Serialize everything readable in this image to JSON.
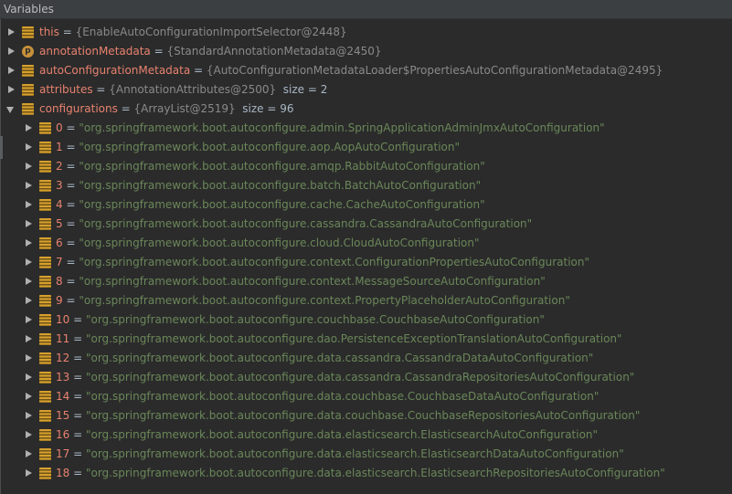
{
  "panel": {
    "title": "Variables"
  },
  "top_vars": [
    {
      "name": "this",
      "value": "{EnableAutoConfigurationImportSelector@2448}",
      "icon": "field-icon",
      "size_text": ""
    },
    {
      "name": "annotationMetadata",
      "value": "{StandardAnnotationMetadata@2450}",
      "icon": "param-icon",
      "icon_letter": "p",
      "size_text": ""
    },
    {
      "name": "autoConfigurationMetadata",
      "value": "{AutoConfigurationMetadataLoader$PropertiesAutoConfigurationMetadata@2495}",
      "icon": "field-icon",
      "size_text": ""
    },
    {
      "name": "attributes",
      "value": "{AnnotationAttributes@2500}",
      "icon": "field-icon",
      "size_text": "size = 2"
    },
    {
      "name": "configurations",
      "value": "{ArrayList@2519}",
      "icon": "field-icon",
      "size_text": "size = 96",
      "expanded": true
    }
  ],
  "items": [
    {
      "index": "0",
      "value": "\"org.springframework.boot.autoconfigure.admin.SpringApplicationAdminJmxAutoConfiguration\""
    },
    {
      "index": "1",
      "value": "\"org.springframework.boot.autoconfigure.aop.AopAutoConfiguration\""
    },
    {
      "index": "2",
      "value": "\"org.springframework.boot.autoconfigure.amqp.RabbitAutoConfiguration\""
    },
    {
      "index": "3",
      "value": "\"org.springframework.boot.autoconfigure.batch.BatchAutoConfiguration\""
    },
    {
      "index": "4",
      "value": "\"org.springframework.boot.autoconfigure.cache.CacheAutoConfiguration\""
    },
    {
      "index": "5",
      "value": "\"org.springframework.boot.autoconfigure.cassandra.CassandraAutoConfiguration\""
    },
    {
      "index": "6",
      "value": "\"org.springframework.boot.autoconfigure.cloud.CloudAutoConfiguration\""
    },
    {
      "index": "7",
      "value": "\"org.springframework.boot.autoconfigure.context.ConfigurationPropertiesAutoConfiguration\""
    },
    {
      "index": "8",
      "value": "\"org.springframework.boot.autoconfigure.context.MessageSourceAutoConfiguration\""
    },
    {
      "index": "9",
      "value": "\"org.springframework.boot.autoconfigure.context.PropertyPlaceholderAutoConfiguration\""
    },
    {
      "index": "10",
      "value": "\"org.springframework.boot.autoconfigure.couchbase.CouchbaseAutoConfiguration\""
    },
    {
      "index": "11",
      "value": "\"org.springframework.boot.autoconfigure.dao.PersistenceExceptionTranslationAutoConfiguration\""
    },
    {
      "index": "12",
      "value": "\"org.springframework.boot.autoconfigure.data.cassandra.CassandraDataAutoConfiguration\""
    },
    {
      "index": "13",
      "value": "\"org.springframework.boot.autoconfigure.data.cassandra.CassandraRepositoriesAutoConfiguration\""
    },
    {
      "index": "14",
      "value": "\"org.springframework.boot.autoconfigure.data.couchbase.CouchbaseDataAutoConfiguration\""
    },
    {
      "index": "15",
      "value": "\"org.springframework.boot.autoconfigure.data.couchbase.CouchbaseRepositoriesAutoConfiguration\""
    },
    {
      "index": "16",
      "value": "\"org.springframework.boot.autoconfigure.data.elasticsearch.ElasticsearchAutoConfiguration\""
    },
    {
      "index": "17",
      "value": "\"org.springframework.boot.autoconfigure.data.elasticsearch.ElasticsearchDataAutoConfiguration\""
    },
    {
      "index": "18",
      "value": "\"org.springframework.boot.autoconfigure.data.elasticsearch.ElasticsearchRepositoriesAutoConfiguration\""
    }
  ]
}
